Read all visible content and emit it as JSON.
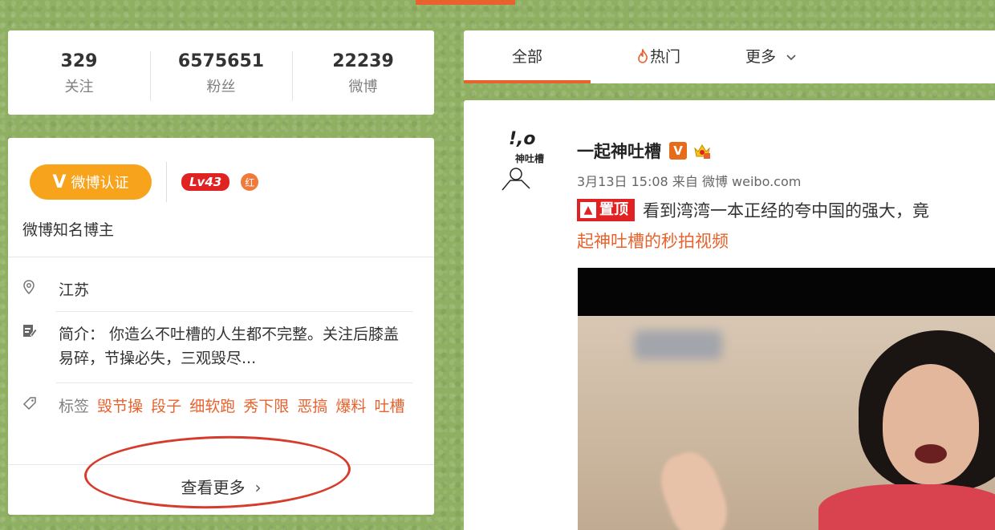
{
  "stats": [
    {
      "num": "329",
      "label": "关注"
    },
    {
      "num": "6575651",
      "label": "粉丝"
    },
    {
      "num": "22239",
      "label": "微博"
    }
  ],
  "profile": {
    "verify_mark": "V",
    "verify_label": "微博认证",
    "level": "Lv43",
    "red_badge": "红",
    "verification_text": "微博知名博主",
    "location": "江苏",
    "intro": "简介： 你造么不吐槽的人生都不完整。关注后膝盖易碎，节操必失，三观毁尽...",
    "tags_label": "标签",
    "tags": [
      "毁节操",
      "段子",
      "细软跑",
      "秀下限",
      "恶搞",
      "爆料",
      "吐槽"
    ],
    "more_label": "查看更多",
    "more_arrow": "›"
  },
  "tabs": {
    "all": "全部",
    "hot": "热门",
    "more": "更多"
  },
  "post": {
    "avatar_text": "!,o",
    "avatar_sub": "神吐槽",
    "username": "一起神吐槽",
    "verified_badge": "V",
    "time": "3月13日 15:08",
    "source_prefix": "来自",
    "source": "微博 weibo.com",
    "pin_label": "置顶",
    "text_line1": "看到湾湾一本正经的夸中国的强大，竟",
    "text_line2": "起神吐槽的秒拍视频"
  },
  "colors": {
    "accent": "#e8622d",
    "verify": "#f7a31c",
    "level": "#e02222",
    "annotation_circle": "#d63b2c",
    "background": "#8fb062"
  }
}
